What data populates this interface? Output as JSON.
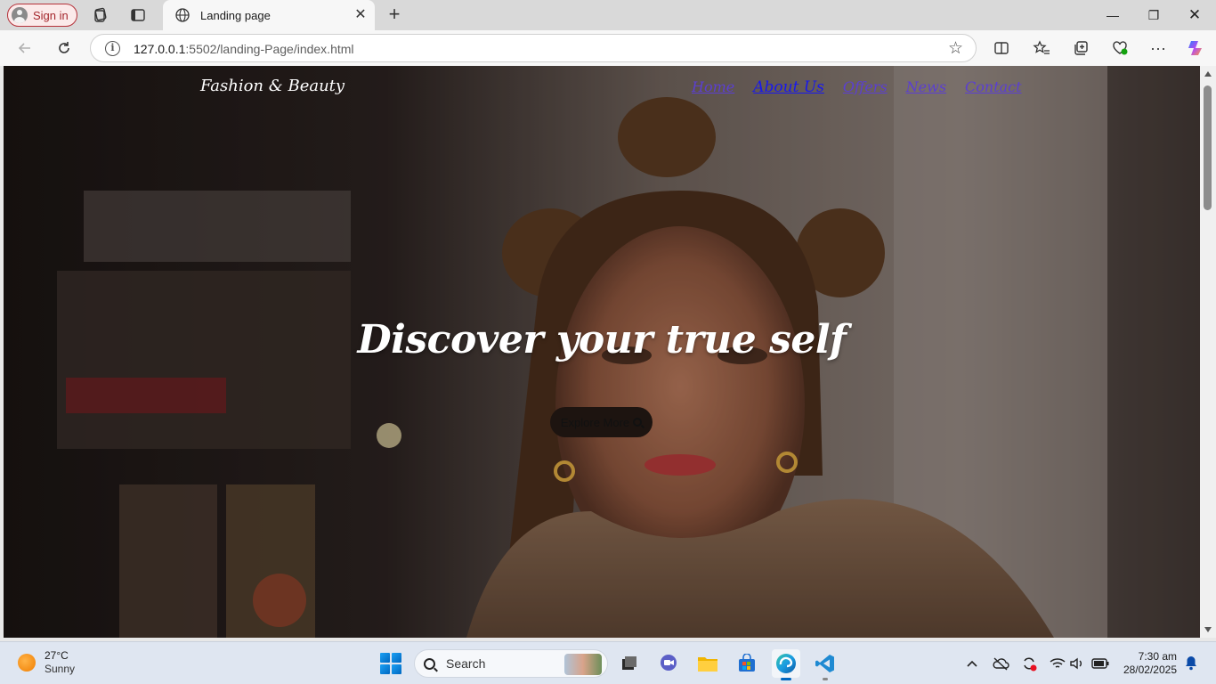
{
  "browser": {
    "signin_label": "Sign in",
    "tab_title": "Landing page",
    "url_host": "127.0.0.1",
    "url_rest": ":5502/landing-Page/index.html"
  },
  "page": {
    "logo": "Fashion & Beauty",
    "nav": [
      "Home",
      "About Us",
      "Offers",
      "News",
      "Contact"
    ],
    "hero_title": "Discover your true self",
    "cta_label": "Explore More"
  },
  "taskbar": {
    "weather_temp": "27°C",
    "weather_cond": "Sunny",
    "search_label": "Search",
    "time": "7:30 am",
    "date": "28/02/2025"
  },
  "colors": {
    "link_visited": "#5b3fd1",
    "link_active": "#1818ee",
    "signin_accent": "#a4262c",
    "taskbar_bg": "#dfe6f1"
  },
  "icons": [
    "user-avatar-icon",
    "workspaces-icon",
    "tab-actions-icon",
    "globe-icon",
    "close-icon",
    "new-tab-icon",
    "back-icon",
    "refresh-icon",
    "info-icon",
    "favorite-star-icon",
    "split-screen-icon",
    "favorites-icon",
    "collections-icon",
    "browser-essentials-icon",
    "more-icon",
    "copilot-icon",
    "windows-start-icon",
    "search-icon",
    "task-view-icon",
    "teams-chat-icon",
    "file-explorer-icon",
    "store-icon",
    "edge-icon",
    "vscode-icon",
    "chevron-up-icon",
    "onedrive-icon",
    "sync-icon",
    "wifi-icon",
    "volume-icon",
    "battery-icon",
    "bell-icon"
  ]
}
